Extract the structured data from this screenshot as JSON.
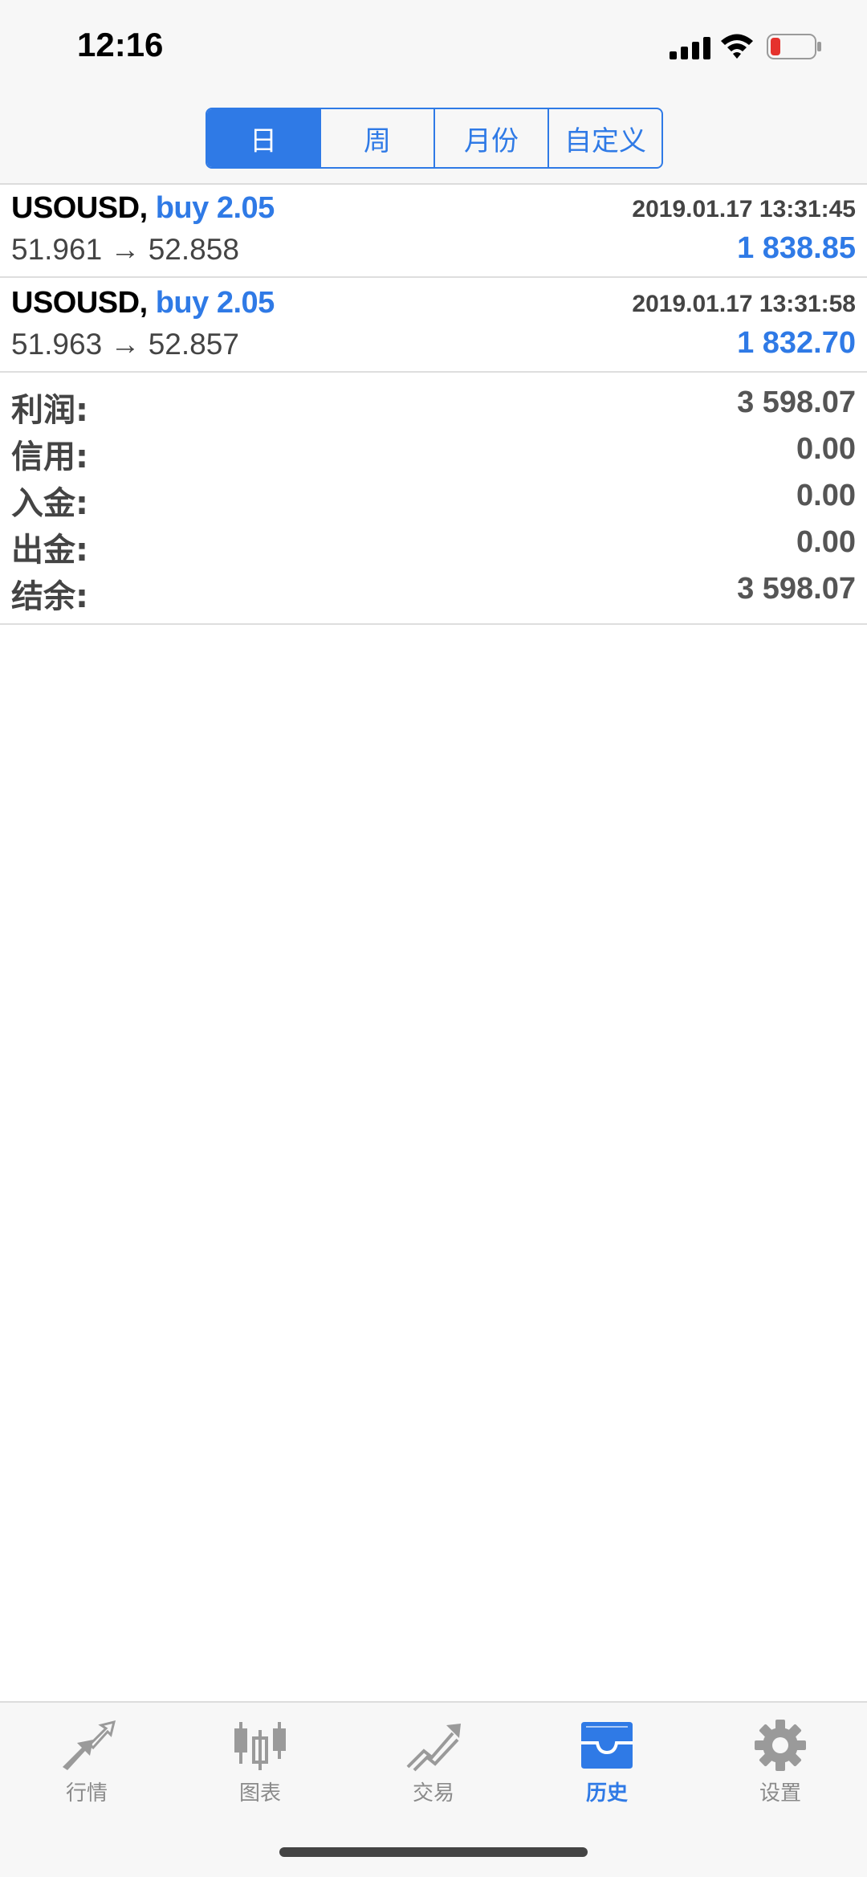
{
  "status_bar": {
    "time": "12:16"
  },
  "segments": [
    {
      "label": "日",
      "active": true
    },
    {
      "label": "周",
      "active": false
    },
    {
      "label": "月份",
      "active": false
    },
    {
      "label": "自定义",
      "active": false
    }
  ],
  "trades": [
    {
      "symbol": "USOUSD,",
      "action": "buy 2.05",
      "timestamp": "2019.01.17 13:31:45",
      "prices": "51.961 → 52.858",
      "profit": "1 838.85"
    },
    {
      "symbol": "USOUSD,",
      "action": "buy 2.05",
      "timestamp": "2019.01.17 13:31:58",
      "prices": "51.963 → 52.857",
      "profit": "1 832.70"
    }
  ],
  "summary": [
    {
      "label": "利润:",
      "value": "3 598.07"
    },
    {
      "label": "信用:",
      "value": "0.00"
    },
    {
      "label": "入金:",
      "value": "0.00"
    },
    {
      "label": "出金:",
      "value": "0.00"
    },
    {
      "label": "结余:",
      "value": "3 598.07"
    }
  ],
  "tabs": [
    {
      "label": "行情",
      "icon": "quotes-icon",
      "active": false
    },
    {
      "label": "图表",
      "icon": "chart-icon",
      "active": false
    },
    {
      "label": "交易",
      "icon": "trade-icon",
      "active": false
    },
    {
      "label": "历史",
      "icon": "history-icon",
      "active": true
    },
    {
      "label": "设置",
      "icon": "settings-icon",
      "active": false
    }
  ],
  "colors": {
    "accent": "#2f7ae6",
    "inactive": "#8a8a8a",
    "battery_low": "#e5322d"
  }
}
